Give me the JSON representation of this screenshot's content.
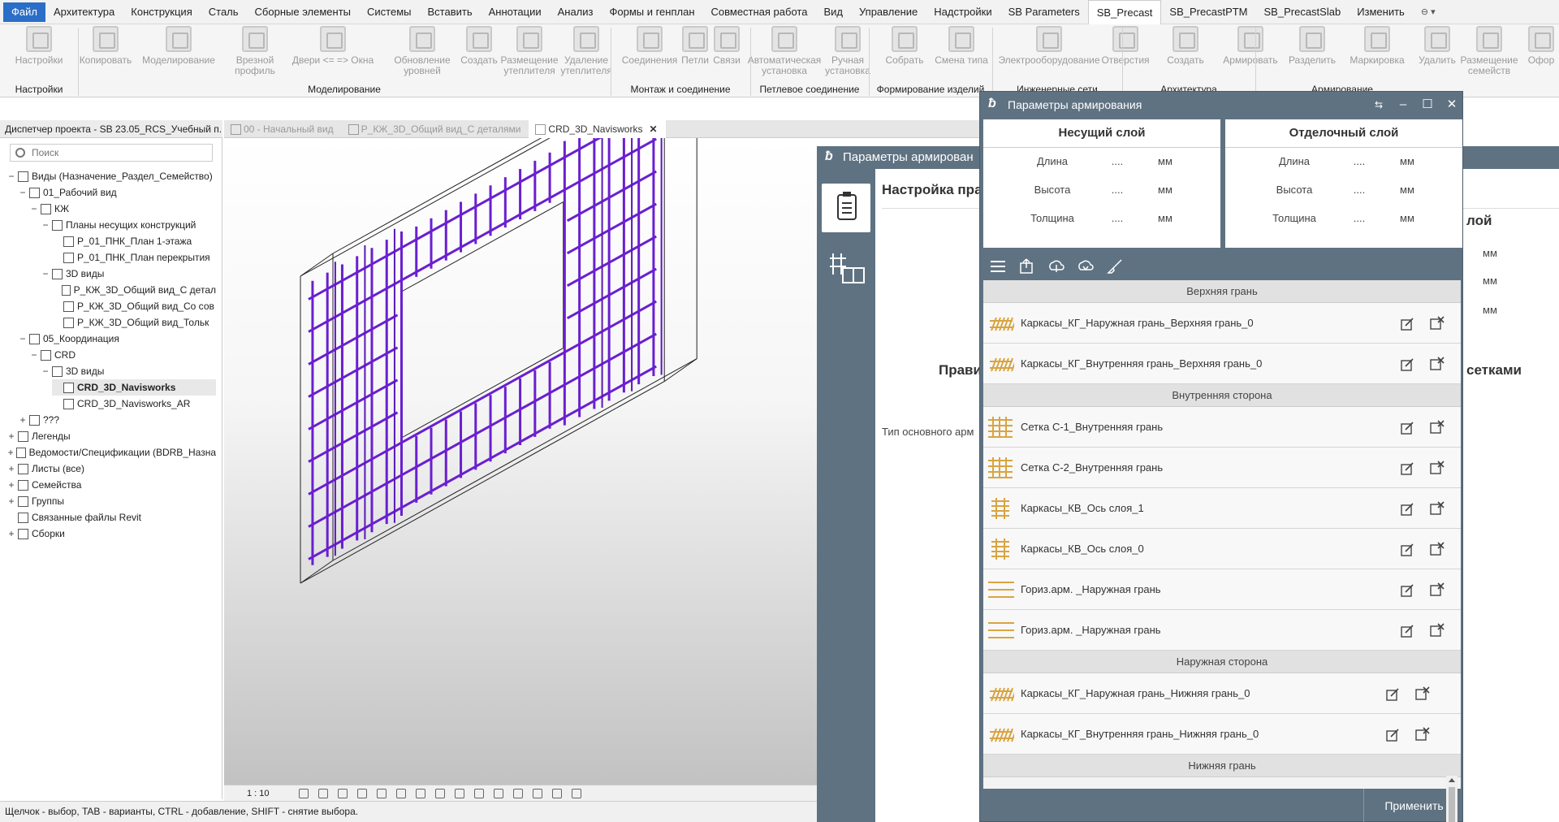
{
  "menu": {
    "items": [
      "Файл",
      "Архитектура",
      "Конструкция",
      "Сталь",
      "Сборные элементы",
      "Системы",
      "Вставить",
      "Аннотации",
      "Анализ",
      "Формы и генплан",
      "Совместная работа",
      "Вид",
      "Управление",
      "Надстройки",
      "SB Parameters",
      "SB_Precast",
      "SB_PrecastPTM",
      "SB_PrecastSlab",
      "Изменить"
    ],
    "active": "SB_Precast"
  },
  "ribbon": {
    "buttons": [
      "Настройки",
      "Копировать",
      "Моделирование",
      "Врезной\nпрофиль",
      "Двери <= => Окна",
      "Обновление\nуровней",
      "Создать",
      "Размещение\nутеплителя",
      "Удаление\nутеплителя",
      "Соединения",
      "Петли",
      "Связи",
      "Автоматическая\nустановка",
      "Ручная\nустановка",
      "Собрать",
      "Смена типа",
      "Электрооборудование",
      "Отверстия",
      "Создать",
      "Армировать",
      "Разделить",
      "Маркировка",
      "Удалить",
      "Размещение\nсемейств",
      "Офор"
    ],
    "groups": [
      "Настройки",
      "Моделирование",
      "Монтаж и соединение",
      "Петлевое соединение",
      "Формирование изделий",
      "Инженерные сети",
      "Архитектура",
      "Армирование"
    ]
  },
  "browser": {
    "title": "Диспетчер проекта - SB 23.05_RCS_Учебный п...",
    "search_placeholder": "Поиск",
    "tree": [
      {
        "label": "Виды (Назначение_Раздел_Семейство)",
        "level": 0,
        "toggle": "−"
      },
      {
        "label": "01_Рабочий вид",
        "level": 1,
        "toggle": "−"
      },
      {
        "label": "КЖ",
        "level": 2,
        "toggle": "−"
      },
      {
        "label": "Планы несущих конструкций",
        "level": 3,
        "toggle": "−"
      },
      {
        "label": "P_01_ПНК_План 1-этажа",
        "level": 4,
        "toggle": ""
      },
      {
        "label": "P_01_ПНК_План перекрытия",
        "level": 4,
        "toggle": ""
      },
      {
        "label": "3D виды",
        "level": 3,
        "toggle": "−"
      },
      {
        "label": "P_КЖ_3D_Общий вид_С детал",
        "level": 4,
        "toggle": ""
      },
      {
        "label": "P_КЖ_3D_Общий вид_Со сов",
        "level": 4,
        "toggle": ""
      },
      {
        "label": "P_КЖ_3D_Общий вид_Тольк",
        "level": 4,
        "toggle": ""
      },
      {
        "label": "05_Координация",
        "level": 1,
        "toggle": "−"
      },
      {
        "label": "CRD",
        "level": 2,
        "toggle": "−"
      },
      {
        "label": "3D виды",
        "level": 3,
        "toggle": "−"
      },
      {
        "label": "CRD_3D_Navisworks",
        "level": 4,
        "toggle": "",
        "selected": true
      },
      {
        "label": "CRD_3D_Navisworks_AR",
        "level": 4,
        "toggle": ""
      },
      {
        "label": "???",
        "level": 1,
        "toggle": "+"
      },
      {
        "label": "Легенды",
        "level": 0,
        "toggle": "+"
      },
      {
        "label": "Ведомости/Спецификации (BDRB_Назна",
        "level": 0,
        "toggle": "+"
      },
      {
        "label": "Листы (все)",
        "level": 0,
        "toggle": "+"
      },
      {
        "label": "Семейства",
        "level": 0,
        "toggle": "+"
      },
      {
        "label": "Группы",
        "level": 0,
        "toggle": "+"
      },
      {
        "label": "Связанные файлы Revit",
        "level": 0,
        "toggle": ""
      },
      {
        "label": "Сборки",
        "level": 0,
        "toggle": "+"
      }
    ]
  },
  "tabs": [
    {
      "label": "00 - Начальный вид",
      "active": false
    },
    {
      "label": "P_КЖ_3D_Общий вид_С деталями",
      "active": false
    },
    {
      "label": "CRD_3D_Navisworks",
      "active": true
    }
  ],
  "viewbar": {
    "scale": "1 : 10"
  },
  "status": "Щелчок - выбор, TAB - варианты, CTRL - добавление, SHIFT - снятие выбора.",
  "bg_window": {
    "title": "Параметры армирован",
    "heading": "Настройка пра",
    "rule_text": "Прави",
    "type_text": "Тип основного арм",
    "layer_text": "лой",
    "mesh_text": "сетками",
    "units": [
      "мм",
      "мм",
      "мм"
    ]
  },
  "dialog": {
    "title": "Параметры армирования",
    "layers": [
      {
        "title": "Несущий слой",
        "params": [
          {
            "k": "Длина",
            "v": "....",
            "u": "мм"
          },
          {
            "k": "Высота",
            "v": "....",
            "u": "мм"
          },
          {
            "k": "Толщина",
            "v": "....",
            "u": "мм"
          }
        ]
      },
      {
        "title": "Отделочный слой",
        "params": [
          {
            "k": "Длина",
            "v": "....",
            "u": "мм"
          },
          {
            "k": "Высота",
            "v": "....",
            "u": "мм"
          },
          {
            "k": "Толщина",
            "v": "....",
            "u": "мм"
          }
        ]
      }
    ],
    "sections": [
      {
        "title": "Верхняя грань",
        "items": [
          {
            "label": "Каркасы_КГ_Наружная грань_Верхняя грань_0",
            "icon": "frame"
          },
          {
            "label": "Каркасы_КГ_Внутренняя грань_Верхняя грань_0",
            "icon": "frame"
          }
        ]
      },
      {
        "title": "Внутренняя сторона",
        "items": [
          {
            "label": "Сетка С-1_Внутренняя грань",
            "icon": "mesh"
          },
          {
            "label": "Сетка С-2_Внутренняя грань",
            "icon": "mesh"
          },
          {
            "label": "Каркасы_КВ_Ось слоя_1",
            "icon": "ladder"
          },
          {
            "label": "Каркасы_КВ_Ось слоя_0",
            "icon": "ladder"
          },
          {
            "label": "Гориз.арм. _Наружная грань",
            "icon": "bars"
          },
          {
            "label": "Гориз.арм. _Наружная грань",
            "icon": "bars"
          }
        ]
      },
      {
        "title": "Наружная сторона",
        "items": [
          {
            "label": "Каркасы_КГ_Наружная грань_Нижняя грань_0",
            "icon": "frame"
          },
          {
            "label": "Каркасы_КГ_Внутренняя грань_Нижняя грань_0",
            "icon": "frame"
          }
        ]
      },
      {
        "title": "Нижняя грань",
        "items": []
      }
    ],
    "apply_label": "Применить"
  },
  "colors": {
    "dialog_bg": "#5f7282",
    "rebar": "#6a1fd0",
    "icon_orange": "#d9a441",
    "file_tab": "#2b6ec8"
  }
}
